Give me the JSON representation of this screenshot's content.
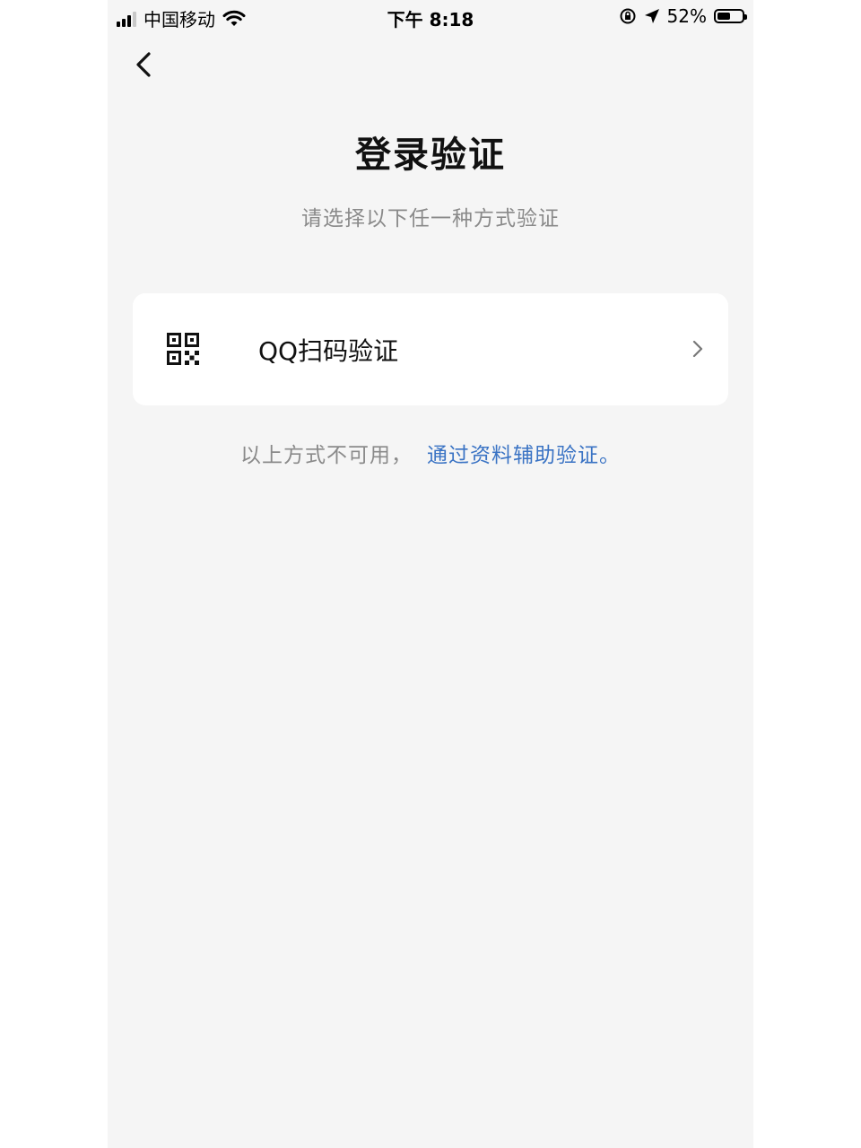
{
  "status_bar": {
    "carrier": "中国移动",
    "time": "下午 8:18",
    "battery": "52%",
    "battery_level": 0.52,
    "signal_bars": 3,
    "icons": [
      "signal-icon",
      "wifi-icon",
      "orientation-lock-icon",
      "location-arrow-icon",
      "battery-icon"
    ]
  },
  "nav": {
    "back_icon": "chevron-left-icon"
  },
  "page": {
    "title": "登录验证",
    "subtitle": "请选择以下任一种方式验证"
  },
  "options": [
    {
      "icon": "qr-code-icon",
      "label": "QQ扫码验证",
      "trailing_icon": "chevron-right-icon"
    }
  ],
  "alternative": {
    "prefix": "以上方式不可用，",
    "link": "通过资料辅助验证。"
  },
  "colors": {
    "background": "#f5f5f5",
    "card": "#ffffff",
    "link": "#3a73c4",
    "secondary_text": "#8a8a8a"
  }
}
